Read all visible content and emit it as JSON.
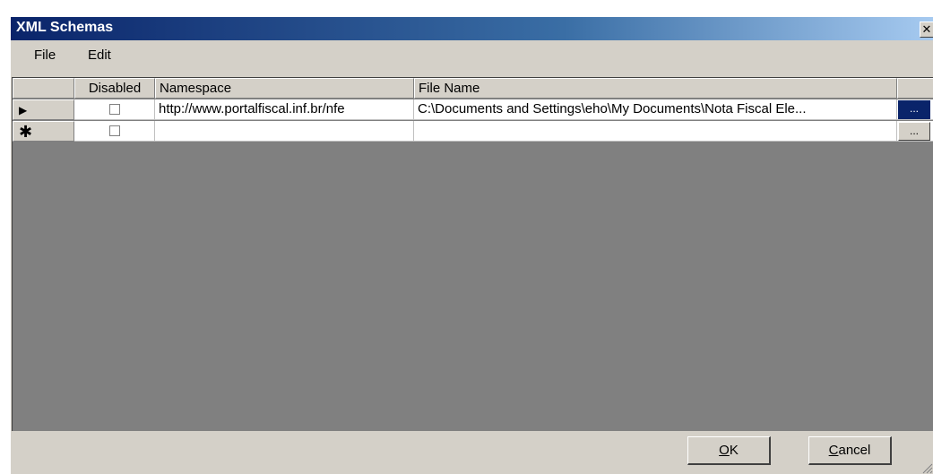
{
  "window": {
    "title": "XML Schemas",
    "close_glyph": "✕"
  },
  "menu": {
    "items": [
      {
        "label": "File"
      },
      {
        "label": "Edit"
      }
    ]
  },
  "grid": {
    "columns": [
      {
        "label": ""
      },
      {
        "label": "Disabled"
      },
      {
        "label": "Namespace"
      },
      {
        "label": "File Name"
      },
      {
        "label": ""
      }
    ],
    "rows": [
      {
        "indicator": "▶",
        "disabled": false,
        "namespace": "http://www.portalfiscal.inf.br/nfe",
        "file_name": "C:\\Documents and Settings\\eho\\My Documents\\Nota Fiscal Ele...",
        "browse_label": "...",
        "selected": true
      },
      {
        "indicator": "✱",
        "disabled": false,
        "namespace": "",
        "file_name": "",
        "browse_label": "...",
        "selected": false
      }
    ]
  },
  "buttons": {
    "ok_mnemonic": "O",
    "ok_rest": "K",
    "cancel_mnemonic": "C",
    "cancel_rest": "ancel"
  }
}
